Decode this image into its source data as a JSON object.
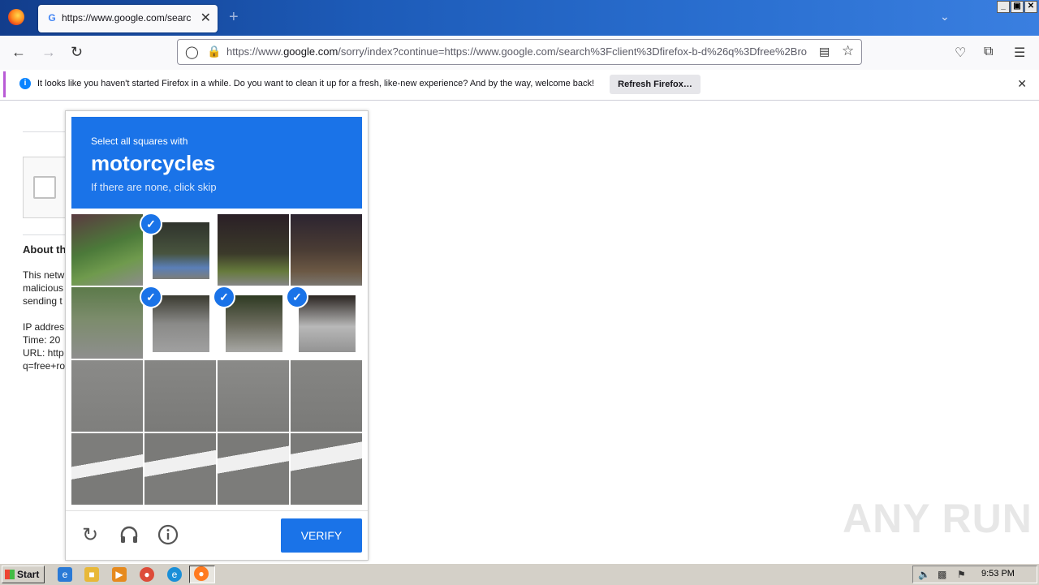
{
  "browser": {
    "tab": {
      "title": "https://www.google.com/search?c",
      "favicon": "G",
      "close": "✕"
    },
    "new_tab": "+",
    "url": {
      "prefix": "https://www.",
      "domain": "google.com",
      "rest": "/sorry/index?continue=https://www.google.com/search%3Fclient%3Dfirefox-b-d%26q%3Dfree%2Bro"
    },
    "notification": {
      "message": "It looks like you haven't started Firefox in a while. Do you want to clean it up for a fresh, like-new experience? And by the way, welcome back!",
      "button": "Refresh Firefox…",
      "info_glyph": "i"
    }
  },
  "page": {
    "about_heading": "About th",
    "para_lines": [
      "This netw",
      "malicious",
      "sending t"
    ],
    "info_lines": [
      "IP addres",
      "Time: 20",
      "URL: http",
      "q=free+ro"
    ]
  },
  "captcha": {
    "instruction": "Select all squares with",
    "object": "motorcycles",
    "hint": "If there are none, click skip",
    "verify_label": "VERIFY",
    "selected_cells": [
      1,
      5,
      6,
      7
    ]
  },
  "watermark": "ANY RUN",
  "taskbar": {
    "start_label": "Start",
    "clock": "9:53 PM"
  }
}
